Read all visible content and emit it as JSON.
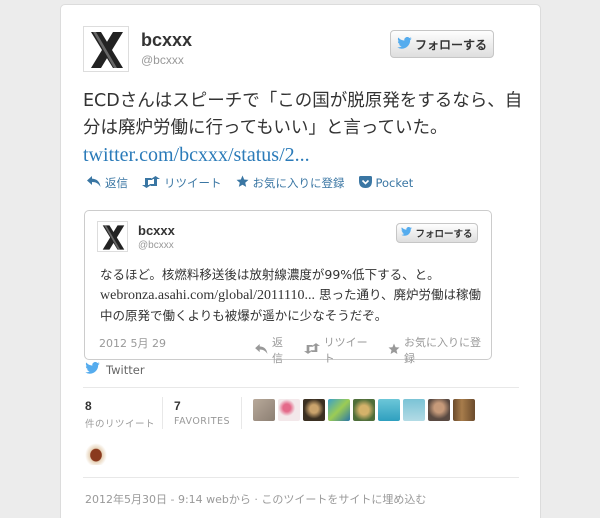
{
  "main_tweet": {
    "display_name": "bcxxx",
    "handle": "@bcxxx",
    "follow_label": "フォローする",
    "text": "ECDさんはスピーチで「この国が脱原発をするなら、自分は廃炉労働に行ってもいい」と言っていた。",
    "link": "twitter.com/bcxxx/status/2...",
    "actions": {
      "reply": "返信",
      "retweet": "リツイート",
      "favorite": "お気に入りに登録",
      "pocket": "Pocket"
    }
  },
  "quoted_tweet": {
    "display_name": "bcxxx",
    "handle": "@bcxxx",
    "follow_label": "フォローする",
    "text_before": "なるほど。核燃料移送後は放射線濃度が99%低下する、と。",
    "link": "webronza.asahi.com/global/2011110...",
    "text_after": " 思った通り、廃炉労働は稼働中の原発で働くよりも被爆が遥かに少なそうだぞ。",
    "date": "2012 5月 29",
    "actions": {
      "reply": "返信",
      "retweet": "リツイート",
      "favorite": "お気に入りに登録"
    }
  },
  "source_label": "Twitter",
  "stats": {
    "retweets_count": "8",
    "retweets_label": "件のリツイート",
    "favorites_count": "7",
    "favorites_label": "FAVORITES"
  },
  "footer": {
    "timestamp": "2012年5月30日 - 9:14",
    "via": "webから",
    "separator": "·",
    "embed": "このツイートをサイトに埋め込む"
  },
  "colors": {
    "link": "#2b7bb9",
    "action": "#3a76a3",
    "twitter_bird": "#55acee",
    "muted": "#999999"
  }
}
